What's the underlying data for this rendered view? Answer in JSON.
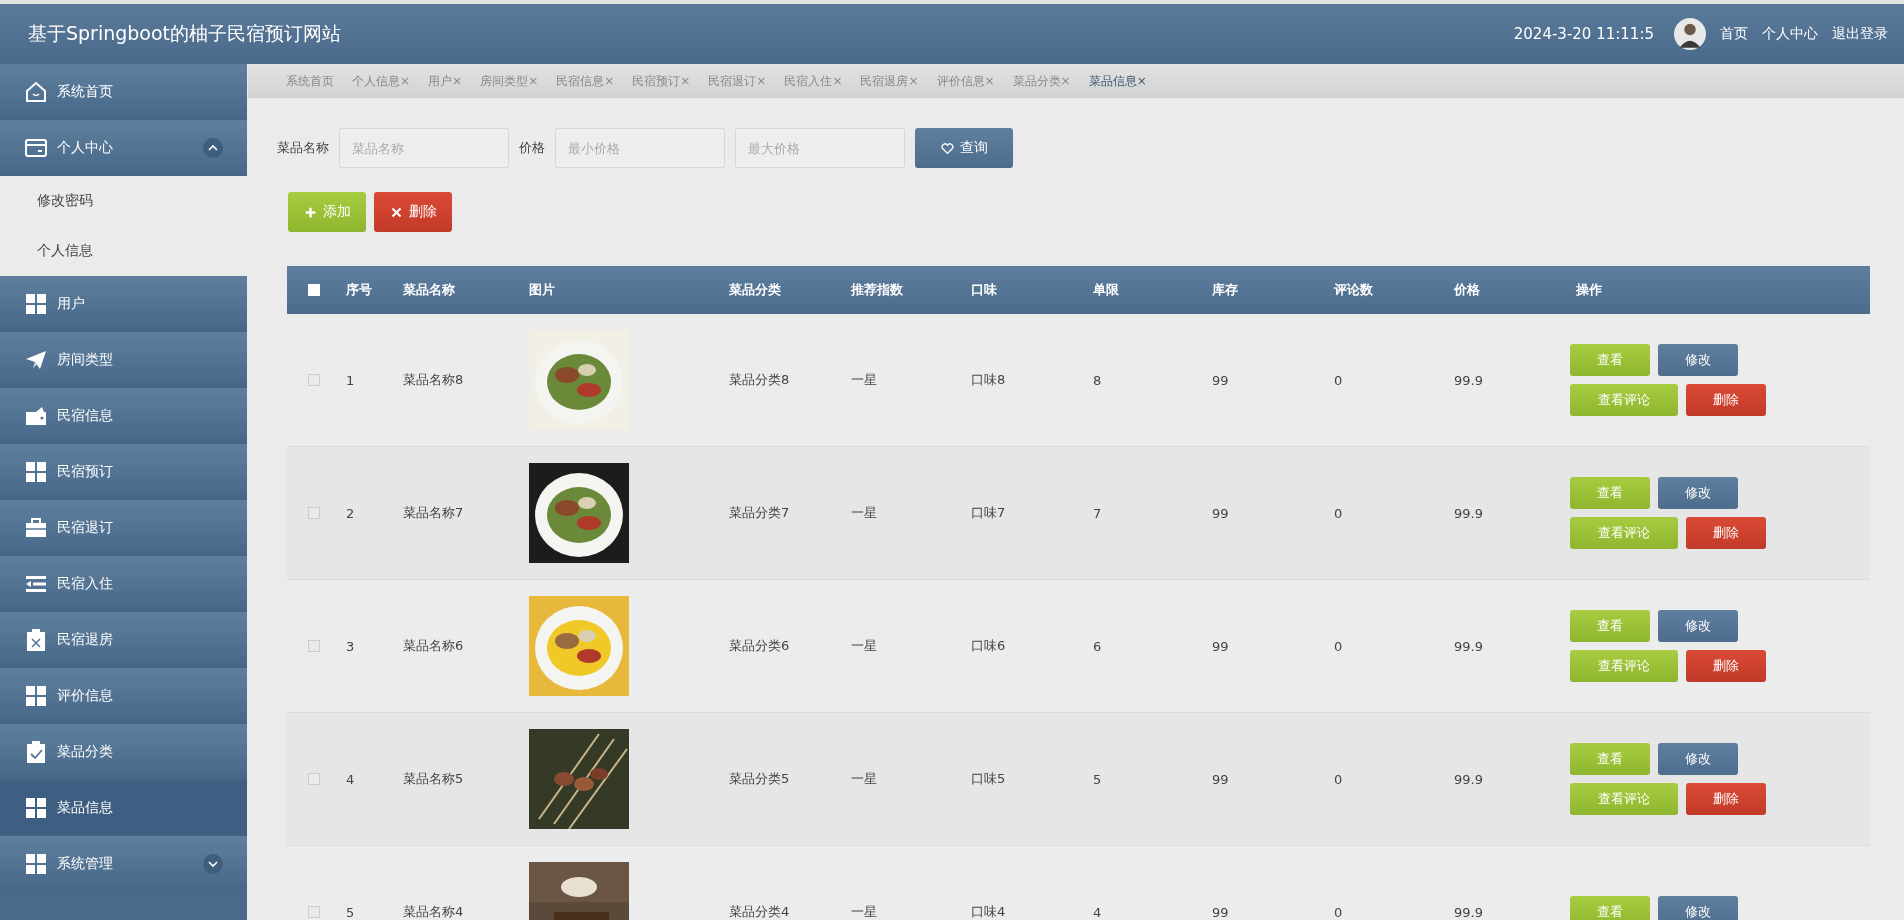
{
  "header": {
    "title": "基于Springboot的柚子民宿预订网站",
    "datetime": "2024-3-20 11:11:5",
    "links": [
      "首页",
      "个人中心",
      "退出登录"
    ]
  },
  "sidebar": {
    "items": [
      {
        "label": "系统首页",
        "selected": false
      },
      {
        "label": "个人中心",
        "selected": false,
        "expanded": true,
        "children": [
          {
            "label": "修改密码",
            "selected": false
          },
          {
            "label": "个人信息",
            "selected": false
          }
        ]
      },
      {
        "label": "用户",
        "selected": false
      },
      {
        "label": "房间类型",
        "selected": false
      },
      {
        "label": "民宿信息",
        "selected": false
      },
      {
        "label": "民宿预订",
        "selected": false
      },
      {
        "label": "民宿退订",
        "selected": false
      },
      {
        "label": "民宿入住",
        "selected": false
      },
      {
        "label": "民宿退房",
        "selected": false
      },
      {
        "label": "评价信息",
        "selected": false
      },
      {
        "label": "菜品分类",
        "selected": false
      },
      {
        "label": "菜品信息",
        "selected": true
      },
      {
        "label": "系统管理",
        "selected": false,
        "expanded": false
      }
    ]
  },
  "tabs": [
    {
      "label": "系统首页",
      "selected": false
    },
    {
      "label": "个人信息",
      "close": "×",
      "selected": false
    },
    {
      "label": "用户",
      "close": "×",
      "selected": false
    },
    {
      "label": "房间类型",
      "close": "×",
      "selected": false
    },
    {
      "label": "民宿信息",
      "close": "×",
      "selected": false
    },
    {
      "label": "民宿预订",
      "close": "×",
      "selected": false
    },
    {
      "label": "民宿退订",
      "close": "×",
      "selected": false
    },
    {
      "label": "民宿入住",
      "close": "×",
      "selected": false
    },
    {
      "label": "民宿退房",
      "close": "×",
      "selected": false
    },
    {
      "label": "评价信息",
      "close": "×",
      "selected": false
    },
    {
      "label": "菜品分类",
      "close": "×",
      "selected": false
    },
    {
      "label": "菜品信息",
      "close": "×",
      "selected": true
    }
  ],
  "search": {
    "name_label": "菜品名称",
    "name_placeholder": "菜品名称",
    "price_label": "价格",
    "min_placeholder": "最小价格",
    "max_placeholder": "最大价格",
    "button": "查询"
  },
  "toolbar": [
    {
      "label": "添加",
      "kind": "add"
    },
    {
      "label": "删除",
      "kind": "delete"
    }
  ],
  "table": {
    "select_all": false,
    "columns": [
      "序号",
      "菜品名称",
      "图片",
      "菜品分类",
      "推荐指数",
      "口味",
      "单限",
      "库存",
      "评论数",
      "价格",
      "操作"
    ],
    "rows": [
      {
        "checked": false,
        "index": "1",
        "name": "菜品名称8",
        "image": {
          "kind": "picture"
        },
        "category": "菜品分类8",
        "rating": "一星",
        "flavor": "口味8",
        "limit": "8",
        "stock": "99",
        "reviews": "0",
        "price": "99.9",
        "actions": [
          {
            "label": "查看",
            "kind": "view"
          },
          {
            "label": "修改",
            "kind": "edit"
          },
          {
            "label": "查看评论",
            "kind": "view"
          },
          {
            "label": "删除",
            "kind": "delete"
          }
        ]
      },
      {
        "checked": false,
        "index": "2",
        "name": "菜品名称7",
        "image": {
          "kind": "picture"
        },
        "category": "菜品分类7",
        "rating": "一星",
        "flavor": "口味7",
        "limit": "7",
        "stock": "99",
        "reviews": "0",
        "price": "99.9",
        "actions": [
          {
            "label": "查看",
            "kind": "view"
          },
          {
            "label": "修改",
            "kind": "edit"
          },
          {
            "label": "查看评论",
            "kind": "view"
          },
          {
            "label": "删除",
            "kind": "delete"
          }
        ]
      },
      {
        "checked": false,
        "index": "3",
        "name": "菜品名称6",
        "image": {
          "kind": "picture"
        },
        "category": "菜品分类6",
        "rating": "一星",
        "flavor": "口味6",
        "limit": "6",
        "stock": "99",
        "reviews": "0",
        "price": "99.9",
        "actions": [
          {
            "label": "查看",
            "kind": "view"
          },
          {
            "label": "修改",
            "kind": "edit"
          },
          {
            "label": "查看评论",
            "kind": "view"
          },
          {
            "label": "删除",
            "kind": "delete"
          }
        ]
      },
      {
        "checked": false,
        "index": "4",
        "name": "菜品名称5",
        "image": {
          "kind": "picture"
        },
        "category": "菜品分类5",
        "rating": "一星",
        "flavor": "口味5",
        "limit": "5",
        "stock": "99",
        "reviews": "0",
        "price": "99.9",
        "actions": [
          {
            "label": "查看",
            "kind": "view"
          },
          {
            "label": "修改",
            "kind": "edit"
          },
          {
            "label": "查看评论",
            "kind": "view"
          },
          {
            "label": "删除",
            "kind": "delete"
          }
        ]
      },
      {
        "checked": false,
        "index": "5",
        "name": "菜品名称4",
        "image": {
          "kind": "picture"
        },
        "category": "菜品分类4",
        "rating": "一星",
        "flavor": "口味4",
        "limit": "4",
        "stock": "99",
        "reviews": "0",
        "price": "99.9",
        "actions": [
          {
            "label": "查看",
            "kind": "view"
          },
          {
            "label": "修改",
            "kind": "edit"
          }
        ]
      }
    ]
  }
}
